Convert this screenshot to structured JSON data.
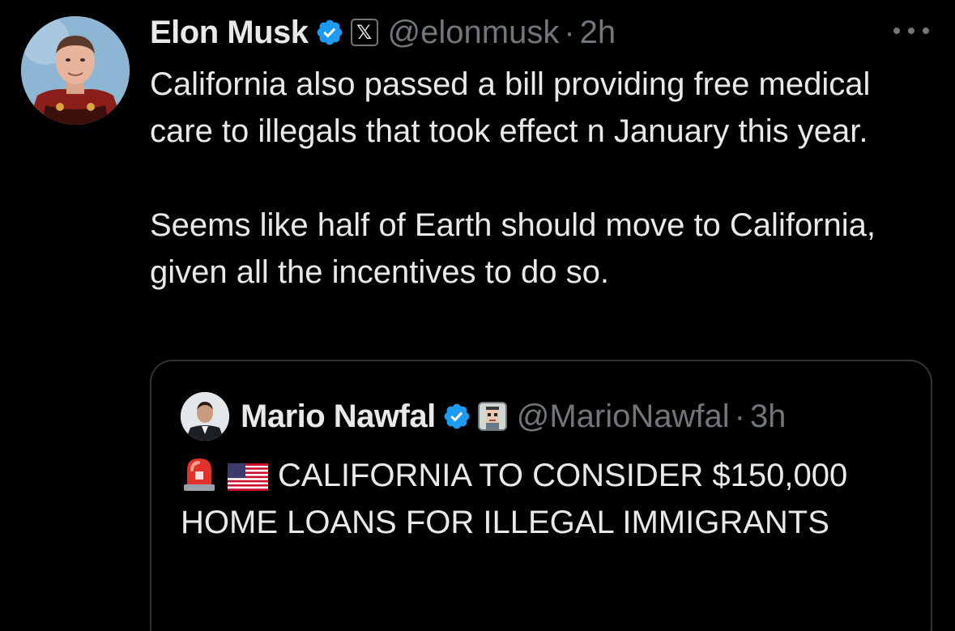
{
  "tweet": {
    "author": {
      "name": "Elon Musk",
      "handle": "@elonmusk",
      "time": "2h",
      "separator": "·",
      "verified": true,
      "affiliation_badge": "x-logo-icon"
    },
    "paragraphs": [
      "California also passed a bill providing free medical care to illegals that took effect n January this year.",
      "Seems like half of Earth should move to California, given all the incentives to do so."
    ],
    "more_icon": "more-horizontal-icon"
  },
  "quoted_tweet": {
    "author": {
      "name": "Mario Nawfal",
      "handle": "@MarioNawfal",
      "time": "3h",
      "separator": "·",
      "verified": true,
      "affiliation_badge": "pixel-avatar-icon"
    },
    "emojis": [
      "rotating-light-emoji",
      "us-flag-emoji"
    ],
    "text": "CALIFORNIA TO CONSIDER $150,000 HOME LOANS FOR ILLEGAL IMMIGRANTS"
  },
  "colors": {
    "background": "#000000",
    "text_primary": "#e7e9ea",
    "text_secondary": "#71767b",
    "verified_blue": "#1d9bf0",
    "border": "#2f3336"
  }
}
